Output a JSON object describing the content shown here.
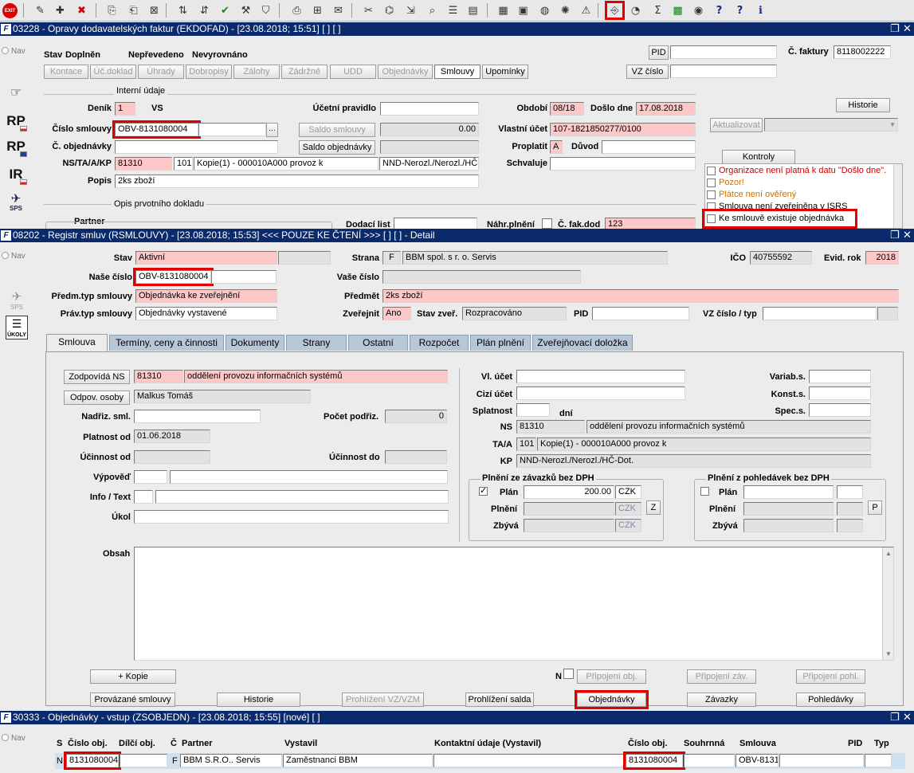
{
  "toolbar": {
    "icons": [
      "exit-icon",
      "new-icon",
      "add-icon",
      "delete-icon",
      "copy-icon",
      "copy-multi-icon",
      "cancel-icon",
      "sort-icon",
      "sort-desc-icon",
      "confirm-icon",
      "tools-icon",
      "filter-icon",
      "print-icon",
      "print-preview-icon",
      "export-icon",
      "cut-icon",
      "paste-icon",
      "import-icon",
      "zoom-icon",
      "list-icon",
      "list-alt-icon",
      "report-icon",
      "save-icon",
      "globe-icon",
      "settings-icon",
      "warning-icon",
      "document-link-icon",
      "clock-icon",
      "sum-icon",
      "excel-icon",
      "web-icon",
      "help-icon",
      "context-help-icon",
      "info-icon"
    ],
    "exit_label": "EXIT"
  },
  "win1": {
    "title": "03228 - Opravy dodavatelských faktur (EKDOFAD) - [23.08.2018; 15:51]  [ ]  [ ]",
    "nav": "Nav",
    "stav_label": "Stav",
    "stav_value": "Doplněn",
    "status2": "Nepřevedeno",
    "status3": "Nevyrovnáno",
    "pid_label": "PID",
    "c_faktury_label": "Č. faktury",
    "c_faktury_value": "8118002222",
    "tabs": [
      "Kontace",
      "Úč.doklad",
      "Úhrady",
      "Dobropisy",
      "Zálohy",
      "Zádržné",
      "UDD",
      "Objednávky",
      "Smlouvy",
      "Upomínky"
    ],
    "vz_cislo_label": "VZ číslo",
    "interni_udaje": "Interní údaje",
    "denik_label": "Deník",
    "denik_value": "1",
    "vs_label": "VS",
    "ucetni_pravidlo_label": "Účetní pravidlo",
    "obdobi_label": "Období",
    "obdobi_value": "08/18",
    "doslo_dne_label": "Došlo dne",
    "doslo_dne_value": "17.08.2018",
    "historie": "Historie",
    "cislo_smlouvy_label": "Číslo smlouvy",
    "cislo_smlouvy_value": "OBV-8131080004",
    "dots": "···",
    "saldo_smlouvy": "Saldo smlouvy",
    "saldo_value": "0.00",
    "vlastni_ucet_label": "Vlastní účet",
    "vlastni_ucet_value": "107-1821850277/0100",
    "aktualizovat": "Aktualizovat",
    "c_objednavky_label": "Č. objednávky",
    "saldo_objednavky": "Saldo objednávky",
    "proplatit_label": "Proplatit",
    "proplatit_value": "A",
    "duvod_label": "Důvod",
    "kontroly": "Kontroly",
    "ns_label": "NS/TA/A/KP",
    "ns_value": "81310",
    "ta_value": "101",
    "kopie_value": "Kopie(1) - 000010A000 provoz k",
    "kp_value": "NND-Nerozl./Nerozl./HČ-D",
    "schvaluje_label": "Schvaluje",
    "popis_label": "Popis",
    "popis_value": "2ks zboží",
    "opis_label": "Opis prvotního dokladu",
    "partner_label": "Partner",
    "dodaci_list_label": "Dodací list",
    "nahr_plneni_label": "Náhr.plnění",
    "c_fak_dod_label": "Č. fak.dod",
    "c_fak_dod_value": "123",
    "kontroly_items": [
      {
        "text": "Organizace není platná k datu \"Došlo dne\".",
        "color": "#cc0000"
      },
      {
        "text": "Pozor!",
        "color": "#d07000"
      },
      {
        "text": "Plátce není ověřený",
        "color": "#d07000"
      },
      {
        "text": "Smlouva není zveřejněna v ISRS",
        "color": "#000000"
      },
      {
        "text": "Ke smlouvě existuje objednávka",
        "color": "#000000"
      }
    ]
  },
  "side1": {
    "items": [
      {
        "name": "hand-document-icon",
        "label": ""
      },
      {
        "name": "rp-cz-icon",
        "label": "RP"
      },
      {
        "name": "rp-eu-icon",
        "label": "RP"
      },
      {
        "name": "ir-cz-icon",
        "label": "IR"
      },
      {
        "name": "sps-icon",
        "label": "SPS"
      }
    ]
  },
  "win2": {
    "title": "08202 - Registr smluv (RSMLOUVY) - [23.08.2018; 15:53] <<< POUZE KE ČTENÍ >>>  [ ]  [ ] - Detail",
    "nav": "Nav",
    "stav_label": "Stav",
    "stav_value": "Aktivní",
    "strana_label": "Strana",
    "strana_code": "F",
    "strana_value": "BBM spol. s r. o. Servis",
    "ico_label": "IČO",
    "ico_value": "40755592",
    "evid_rok_label": "Evid. rok",
    "evid_rok_value": "2018",
    "nase_cislo_label": "Naše číslo",
    "nase_cislo_value": "OBV-8131080004",
    "vase_cislo_label": "Vaše číslo",
    "predm_typ_label": "Předm.typ smlouvy",
    "predm_typ_value": "Objednávka ke zveřejnění",
    "predmet_label": "Předmět",
    "predmet_value": "2ks zboží",
    "prav_typ_label": "Práv.typ smlouvy",
    "prav_typ_value": "Objednávky vystavené",
    "zverejnit_label": "Zveřejnit",
    "zverejnit_value": "Ano",
    "stav_zver_label": "Stav zveř.",
    "stav_zver_value": "Rozpracováno",
    "pid_label": "PID",
    "vz_cislo_label": "VZ číslo / typ",
    "tabs": [
      "Smlouva",
      "Termíny, ceny a činnosti",
      "Dokumenty",
      "Strany",
      "Ostatní",
      "Rozpočet",
      "Plán plnění",
      "Zveřejňovací doložka"
    ],
    "zodpovida_ns": "Zodpovídá NS",
    "zodpovida_code": "81310",
    "zodpovida_value": "oddělení provozu informačních systémů",
    "odpov_osoby": "Odpov. osoby",
    "odpov_value": "Malkus Tomáš",
    "nadriz_label": "Nadřiz. sml.",
    "pocet_podriz_label": "Počet podřiz.",
    "pocet_podriz_value": "0",
    "platnost_label": "Platnost od",
    "platnost_value": "01.06.2018",
    "ucinnost_od_label": "Účinnost od",
    "ucinnost_do_label": "Účinnost do",
    "vypoved_label": "Výpověď",
    "info_label": "Info / Text",
    "ukol_label": "Úkol",
    "vl_ucet_label": "Vl. účet",
    "cizi_ucet_label": "Cizí účet",
    "splatnost_label": "Splatnost",
    "dni": "dní",
    "variab_label": "Variab.s.",
    "konst_label": "Konst.s.",
    "spec_label": "Spec.s.",
    "ns_label": "NS",
    "ns_code": "81310",
    "ns_value": "oddělení provozu informačních systémů",
    "ta_label": "TA/A",
    "ta_code": "101",
    "ta_value": "Kopie(1) - 000010A000 provoz k",
    "kp_label": "KP",
    "kp_value": "NND-Nerozl./Nerozl./HČ-Dot.",
    "plneni_zav_title": "Plnění ze závazků bez DPH",
    "plan_label": "Plán",
    "plan_value": "200.00",
    "czk": "CZK",
    "plneni_label": "Plnění",
    "zbyva_label": "Zbývá",
    "z_btn": "Z",
    "plneni_pohl_title": "Plnění z pohledávek bez DPH",
    "p_btn": "P",
    "obsah_label": "Obsah",
    "kopie_btn": "+ Kopie",
    "n_label": "N",
    "pripojeni_obj": "Připojení obj.",
    "pripojeni_zav": "Připojení záv.",
    "pripojeni_pohl": "Připojení pohl.",
    "provazane": "Provázané smlouvy",
    "historie": "Historie",
    "prohlizeni_vz": "Prohlížení VZ/VZM",
    "prohlizeni_salda": "Prohlížení salda",
    "objednavky": "Objednávky",
    "zavazky": "Závazky",
    "pohledavky": "Pohledávky"
  },
  "side2": {
    "items": [
      {
        "name": "sps-icon",
        "label": "SPS"
      },
      {
        "name": "ukoly-icon",
        "label": "ÚKOLY"
      }
    ]
  },
  "win3": {
    "title": "30333 - Objednávky - vstup (ZSOBJEDN) - [23.08.2018; 15:55]  [nové]  [ ]",
    "nav": "Nav",
    "columns": [
      "S",
      "Číslo obj.",
      "Dílčí obj.",
      "Č",
      "Partner",
      "Vystavil",
      "Kontaktní údaje (Vystavil)",
      "Číslo obj.",
      "Souhrnná",
      "Smlouva",
      "PID",
      "Typ"
    ],
    "row": {
      "s": "N",
      "cislo": "8131080004",
      "c": "F",
      "partner": "BBM S.R.O.. Servis",
      "vystavil": "Zaměstnanci BBM",
      "cislo2": "8131080004",
      "smlouva": "OBV-8131"
    }
  },
  "colors": {
    "title_bar": "#0a2a6b",
    "highlight": "#e00000",
    "pink_field": "#ffc8c8",
    "tab_inactive": "#b8c7d6"
  }
}
